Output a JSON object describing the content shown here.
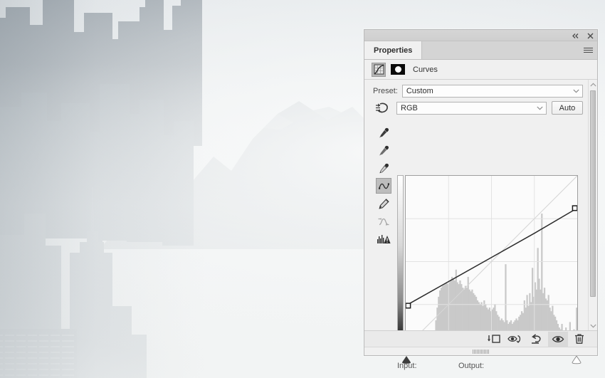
{
  "background": {
    "scene_description": "Hazy desaturated cityscape with skyscrapers on the left and distant mountains"
  },
  "panel": {
    "titlebar": {
      "collapse_label": "collapse-to-icons",
      "collapse_icon": "double-chevron-left-icon",
      "close_label": "close",
      "close_icon": "close-x-icon"
    },
    "tab": {
      "label": "Properties",
      "menu_icon": "hamburger-menu-icon"
    },
    "adjustment": {
      "type_icon": "curves-adjustment-icon",
      "mask_icon": "layer-mask-thumbnail",
      "title": "Curves"
    },
    "preset": {
      "label": "Preset:",
      "value": "Custom",
      "placeholder": "Custom",
      "chevron_icon": "chevron-down-icon"
    },
    "channel": {
      "target_adjust_icon": "on-image-adjustment-icon",
      "value": "RGB",
      "chevron_icon": "chevron-down-icon",
      "auto_label": "Auto"
    },
    "tools": [
      {
        "name": "sample-black-point-eyedropper",
        "icon": "eyedropper-icon",
        "selected": false
      },
      {
        "name": "sample-gray-point-eyedropper",
        "icon": "eyedropper-icon",
        "selected": false
      },
      {
        "name": "sample-white-point-eyedropper",
        "icon": "eyedropper-icon",
        "selected": false
      },
      {
        "name": "edit-points-curve-tool",
        "icon": "curve-tool-icon",
        "selected": true
      },
      {
        "name": "draw-curve-pencil-tool",
        "icon": "pencil-icon",
        "selected": false
      },
      {
        "name": "smooth-curve-values",
        "icon": "smooth-curve-icon",
        "selected": false
      },
      {
        "name": "clipping-warning",
        "icon": "histogram-warning-icon",
        "selected": false
      }
    ],
    "readout": {
      "input_label": "Input:",
      "input_value": "",
      "output_label": "Output:",
      "output_value": ""
    },
    "footer": [
      {
        "name": "clip-to-layer-button",
        "icon": "clip-to-layer-icon",
        "active": false
      },
      {
        "name": "toggle-previous-state-button",
        "icon": "eye-with-arrow-icon",
        "active": false
      },
      {
        "name": "reset-adjustment-button",
        "icon": "reset-arrow-icon",
        "active": false
      },
      {
        "name": "toggle-layer-visibility-button",
        "icon": "eye-icon",
        "active": true
      },
      {
        "name": "delete-adjustment-layer-button",
        "icon": "trash-icon",
        "active": false
      }
    ],
    "scrollbar": {
      "up_icon": "chevron-up-icon",
      "down_icon": "chevron-down-icon"
    },
    "resize_grip_icon": "resize-grip-icon"
  },
  "colors": {
    "panel_bg": "#f0f0f0",
    "panel_border": "#b9b9b9",
    "tab_active_bg": "#f0f0f0",
    "graph_bg": "#fbfbfb",
    "curve_stroke": "#2b2b2b",
    "histogram_fill": "#c9c9c9",
    "grid_line": "#e2e2e2"
  },
  "chart_data": {
    "type": "line",
    "title": "Curves",
    "xlabel": "Input",
    "ylabel": "Output",
    "xlim": [
      0,
      255
    ],
    "ylim": [
      0,
      255
    ],
    "grid": true,
    "grid_divisions": 4,
    "baseline_identity": [
      [
        0,
        0
      ],
      [
        255,
        255
      ]
    ],
    "control_points": [
      [
        0,
        62
      ],
      [
        255,
        207
      ]
    ],
    "curve_points": [
      [
        0,
        62
      ],
      [
        64,
        98
      ],
      [
        128,
        134
      ],
      [
        192,
        170
      ],
      [
        255,
        207
      ]
    ],
    "histogram": {
      "bins": 128,
      "values": [
        1,
        1,
        1,
        1,
        1,
        1,
        1,
        1,
        1,
        1,
        2,
        2,
        2,
        2,
        2,
        2,
        2,
        3,
        4,
        6,
        10,
        18,
        30,
        44,
        56,
        63,
        66,
        68,
        69,
        70,
        71,
        70,
        72,
        74,
        78,
        76,
        74,
        86,
        72,
        70,
        74,
        70,
        66,
        64,
        68,
        66,
        78,
        64,
        62,
        64,
        60,
        58,
        56,
        52,
        50,
        48,
        50,
        46,
        52,
        48,
        44,
        42,
        44,
        40,
        42,
        44,
        48,
        40,
        36,
        34,
        30,
        32,
        30,
        28,
        92,
        30,
        26,
        28,
        30,
        26,
        28,
        30,
        32,
        30,
        34,
        36,
        40,
        38,
        52,
        44,
        58,
        46,
        60,
        50,
        88,
        56,
        72,
        64,
        110,
        76,
        64,
        148,
        60,
        66,
        54,
        52,
        58,
        44,
        40,
        46,
        36,
        34,
        30,
        26,
        22,
        20,
        26,
        18,
        16,
        22,
        14,
        18,
        28,
        16,
        12,
        20,
        14,
        44
      ]
    }
  }
}
